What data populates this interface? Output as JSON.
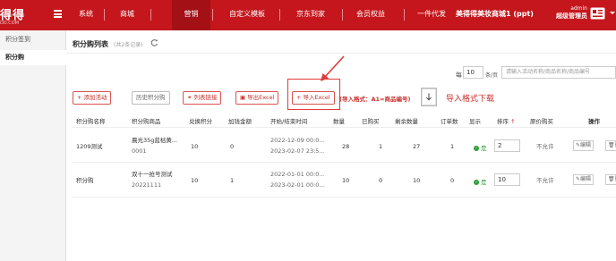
{
  "logo": {
    "main": "得得",
    "sub": "DD.COM"
  },
  "nav": [
    "系统",
    "商城",
    "营销",
    "自定义模板",
    "京东到家",
    "会员权益",
    "一件代发"
  ],
  "shop_name": "美得得美妆商城1 (ppt)",
  "admin": {
    "name": "admin",
    "role": "超级管理员"
  },
  "sidebar": {
    "items": [
      "积分签到",
      "积分购"
    ]
  },
  "page": {
    "title": "积分购列表",
    "count": "(共2条记录)"
  },
  "pagination": {
    "label": "每",
    "value": "10",
    "unit": "条/页"
  },
  "search": {
    "placeholder": "请输入活动名称/商品名称/商品编号"
  },
  "toolbar": {
    "add": "添加活动",
    "history": "历史积分购",
    "link": "列表链接",
    "export": "导出Excel",
    "import": "导入Excel",
    "hint": "(导入格式：A1=商品编号)",
    "download": "导入格式下载"
  },
  "table": {
    "headers": [
      "积分购名称",
      "积分购商品",
      "兑换积分",
      "加钱金额",
      "开始/结束时间",
      "数量",
      "已购买",
      "剩余数量",
      "订单数",
      "显示",
      "排序",
      "原价购买",
      "操作"
    ],
    "rows": [
      {
        "name": "1209测试",
        "product": "晨光35g蓝枯黄...",
        "product_code": "0001",
        "points": "10",
        "money": "0",
        "start": "2022-12-09 00:0...",
        "end": "2023-02-07 23:5...",
        "qty": "28",
        "bought": "1",
        "remaining": "27",
        "orders": "1",
        "show": "是",
        "sort": "2",
        "original": "不允许",
        "edit": "编辑",
        "del": "删"
      },
      {
        "name": "积分购",
        "product": "双十一抢号测试",
        "product_code": "20221111",
        "points": "10",
        "money": "1",
        "start": "2022-01-01 00:0...",
        "end": "2023-02-01 00:0...",
        "qty": "10",
        "bought": "0",
        "remaining": "10",
        "orders": "0",
        "show": "是",
        "sort": "10",
        "original": "不允许",
        "edit": "编辑",
        "del": "删"
      }
    ]
  },
  "colors": {
    "brand": "#c4161c",
    "accent": "#c9302c",
    "success": "#2e9c3a"
  }
}
